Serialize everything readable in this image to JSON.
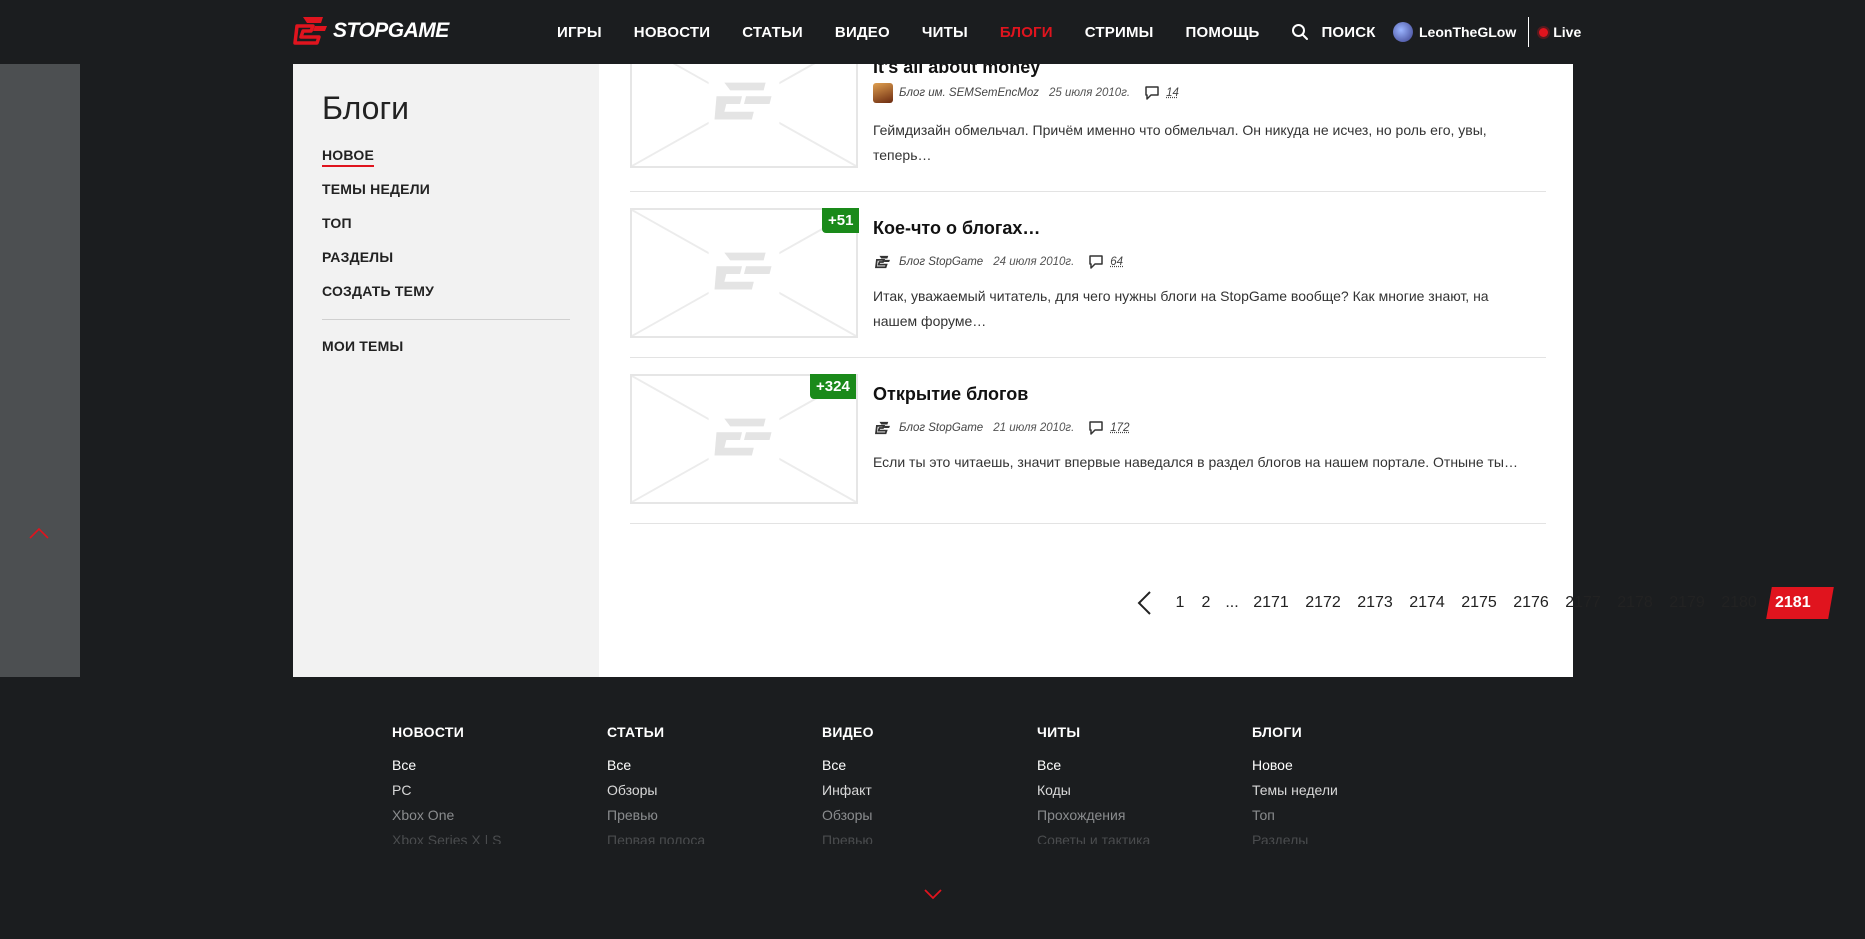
{
  "header": {
    "logo_text": "STOPGAME",
    "nav": [
      {
        "label": "ИГРЫ",
        "active": false
      },
      {
        "label": "НОВОСТИ",
        "active": false
      },
      {
        "label": "СТАТЬИ",
        "active": false
      },
      {
        "label": "ВИДЕО",
        "active": false
      },
      {
        "label": "ЧИТЫ",
        "active": false
      },
      {
        "label": "БЛОГИ",
        "active": true
      },
      {
        "label": "СТРИМЫ",
        "active": false
      },
      {
        "label": "ПОМОЩЬ",
        "active": false
      }
    ],
    "search_label": "ПОИСК",
    "username": "LeonTheGLow",
    "live_label": "Live",
    "accent_color": "#e0141e"
  },
  "sidebar": {
    "title": "Блоги",
    "links": [
      {
        "label": "НОВОЕ",
        "active": true
      },
      {
        "label": "ТЕМЫ НЕДЕЛИ",
        "active": false
      },
      {
        "label": "ТОП",
        "active": false
      },
      {
        "label": "РАЗДЕЛЫ",
        "active": false
      },
      {
        "label": "СОЗДАТЬ ТЕМУ",
        "active": false
      }
    ],
    "my_topics": "МОИ ТЕМЫ"
  },
  "posts": [
    {
      "title": "It's all about money",
      "blog": "Блог им. SEMSemEncMoz",
      "date": "25 июля 2010г.",
      "comments": "14",
      "excerpt": "Геймдизайн обмельчал. Причём именно что обмельчал. Он никуда не исчез, но роль его, увы, теперь…"
    },
    {
      "rating": "+51",
      "title": "Кое-что о блогах…",
      "blog": "Блог StopGame",
      "date": "24 июля 2010г.",
      "comments": "64",
      "excerpt": "Итак, уважаемый читатель, для чего нужны блоги на StopGame вообще? Как многие знают, на нашем форуме…"
    },
    {
      "rating": "+324",
      "title": "Открытие блогов",
      "blog": "Блог StopGame",
      "date": "21 июля 2010г.",
      "comments": "172",
      "excerpt": "Если ты это читаешь, значит впервые наведался в раздел блогов на нашем портале. Отныне ты…"
    }
  ],
  "pagination": {
    "first_pages": [
      "1",
      "2"
    ],
    "ellipsis": "...",
    "pages": [
      "2171",
      "2172",
      "2173",
      "2174",
      "2175",
      "2176",
      "2177",
      "2178",
      "2179",
      "2180"
    ],
    "current": "2181"
  },
  "footer": {
    "columns": [
      {
        "title": "НОВОСТИ",
        "links": [
          "Все",
          "PC",
          "Xbox One",
          "Xbox Series X | S"
        ]
      },
      {
        "title": "СТАТЬИ",
        "links": [
          "Все",
          "Обзоры",
          "Превью",
          "Первая полоса"
        ]
      },
      {
        "title": "ВИДЕО",
        "links": [
          "Все",
          "Инфакт",
          "Обзоры",
          "Превью"
        ]
      },
      {
        "title": "ЧИТЫ",
        "links": [
          "Все",
          "Коды",
          "Прохождения",
          "Советы и тактика"
        ]
      },
      {
        "title": "БЛОГИ",
        "links": [
          "Новое",
          "Темы недели",
          "Топ",
          "Разделы"
        ]
      }
    ]
  }
}
